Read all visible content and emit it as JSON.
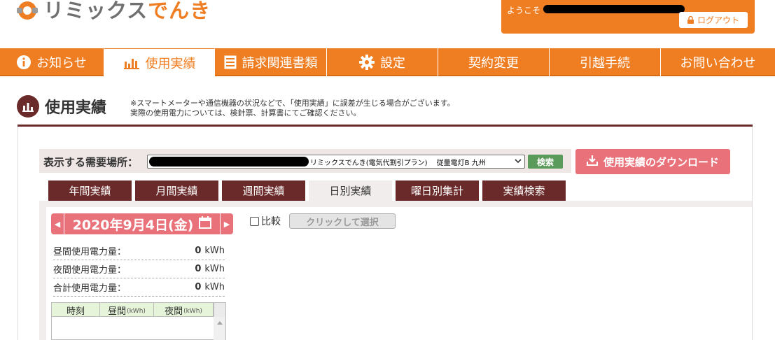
{
  "header": {
    "logo_text_a": "リミックス",
    "logo_text_b": "でんき",
    "welcome": "ようこそ",
    "logout": "ログアウト"
  },
  "nav": [
    {
      "label": "お知らせ",
      "icon": "info-icon",
      "active": false
    },
    {
      "label": "使用実績",
      "icon": "bar-chart-icon",
      "active": true
    },
    {
      "label": "請求関連書類",
      "icon": "document-icon",
      "active": false
    },
    {
      "label": "設定",
      "icon": "gear-icon",
      "active": false
    },
    {
      "label": "契約変更",
      "icon": "",
      "active": false
    },
    {
      "label": "引越手続",
      "icon": "",
      "active": false
    },
    {
      "label": "お問い合わせ",
      "icon": "",
      "active": false
    }
  ],
  "section": {
    "title": "使用実績",
    "note_line1": "※スマートメーターや通信機器の状況などで、「使用実績」に誤差が生じる場合がございます。",
    "note_line2": "実際の使用電力については、検針票、計算書にてご確認ください。"
  },
  "place": {
    "label": "表示する需要場所：",
    "selected": "リミックスでんき(電気代割引プラン)　 従量電灯B 九州",
    "search": "検索"
  },
  "download_button": "使用実績のダウンロード",
  "tabs": [
    "年間実績",
    "月間実績",
    "週間実績",
    "日別実績",
    "曜日別集計",
    "実績検索"
  ],
  "active_tab": "日別実績",
  "date": {
    "label": "2020年9月4日(金)",
    "prev": "◀",
    "next": "▶"
  },
  "compare": {
    "label": "比較",
    "select_button": "クリックして選択"
  },
  "stats": [
    {
      "label": "昼間使用電力量：",
      "value": "0",
      "unit": "kWh"
    },
    {
      "label": "夜間使用電力量：",
      "value": "0",
      "unit": "kWh"
    },
    {
      "label": "合計使用電力量：",
      "value": "0",
      "unit": "kWh"
    }
  ],
  "table": {
    "col_time": "時刻",
    "col_day": "昼間",
    "col_night": "夜間",
    "unit": "(kWh)"
  },
  "colors": {
    "accent_orange": "#ef7d22",
    "maroon": "#6b2a2a",
    "pink": "#e8717a",
    "green": "#5a9a5a"
  }
}
